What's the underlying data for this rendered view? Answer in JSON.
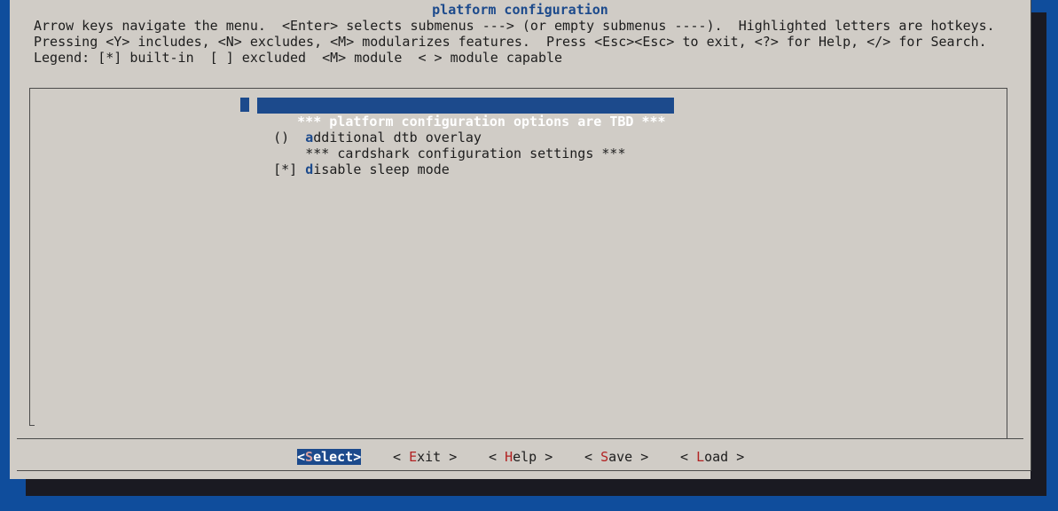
{
  "dialog": {
    "title": "platform configuration",
    "help_lines": [
      "Arrow keys navigate the menu.  <Enter> selects submenus ---> (or empty submenus ----).  Highlighted letters are hotkeys.",
      "Pressing <Y> includes, <N> excludes, <M> modularizes features.  Press <Esc><Esc> to exit, <?> for Help, </> for Search.",
      "Legend: [*] built-in  [ ] excluded  <M> module  < > module capable"
    ]
  },
  "menu": {
    "items": [
      {
        "prefix": "",
        "hotkey": "",
        "text": " *** platform configuration options are TBD ***",
        "selected": true
      },
      {
        "prefix": "()  ",
        "hotkey": "a",
        "text": "dditional dtb overlay",
        "selected": false
      },
      {
        "prefix": "    ",
        "hotkey": "",
        "text": "*** cardshark configuration settings ***",
        "selected": false
      },
      {
        "prefix": "[*] ",
        "hotkey": "d",
        "text": "isable sleep mode",
        "selected": false
      }
    ]
  },
  "buttons": [
    {
      "open": "<",
      "hotkey": "S",
      "rest": "elect",
      "close": ">",
      "active": true
    },
    {
      "open": "< ",
      "hotkey": "E",
      "rest": "xit",
      "close": " >",
      "active": false
    },
    {
      "open": "< ",
      "hotkey": "H",
      "rest": "elp",
      "close": " >",
      "active": false
    },
    {
      "open": "< ",
      "hotkey": "S",
      "rest": "ave",
      "close": " >",
      "active": false
    },
    {
      "open": "< ",
      "hotkey": "L",
      "rest": "oad",
      "close": " >",
      "active": false
    }
  ]
}
